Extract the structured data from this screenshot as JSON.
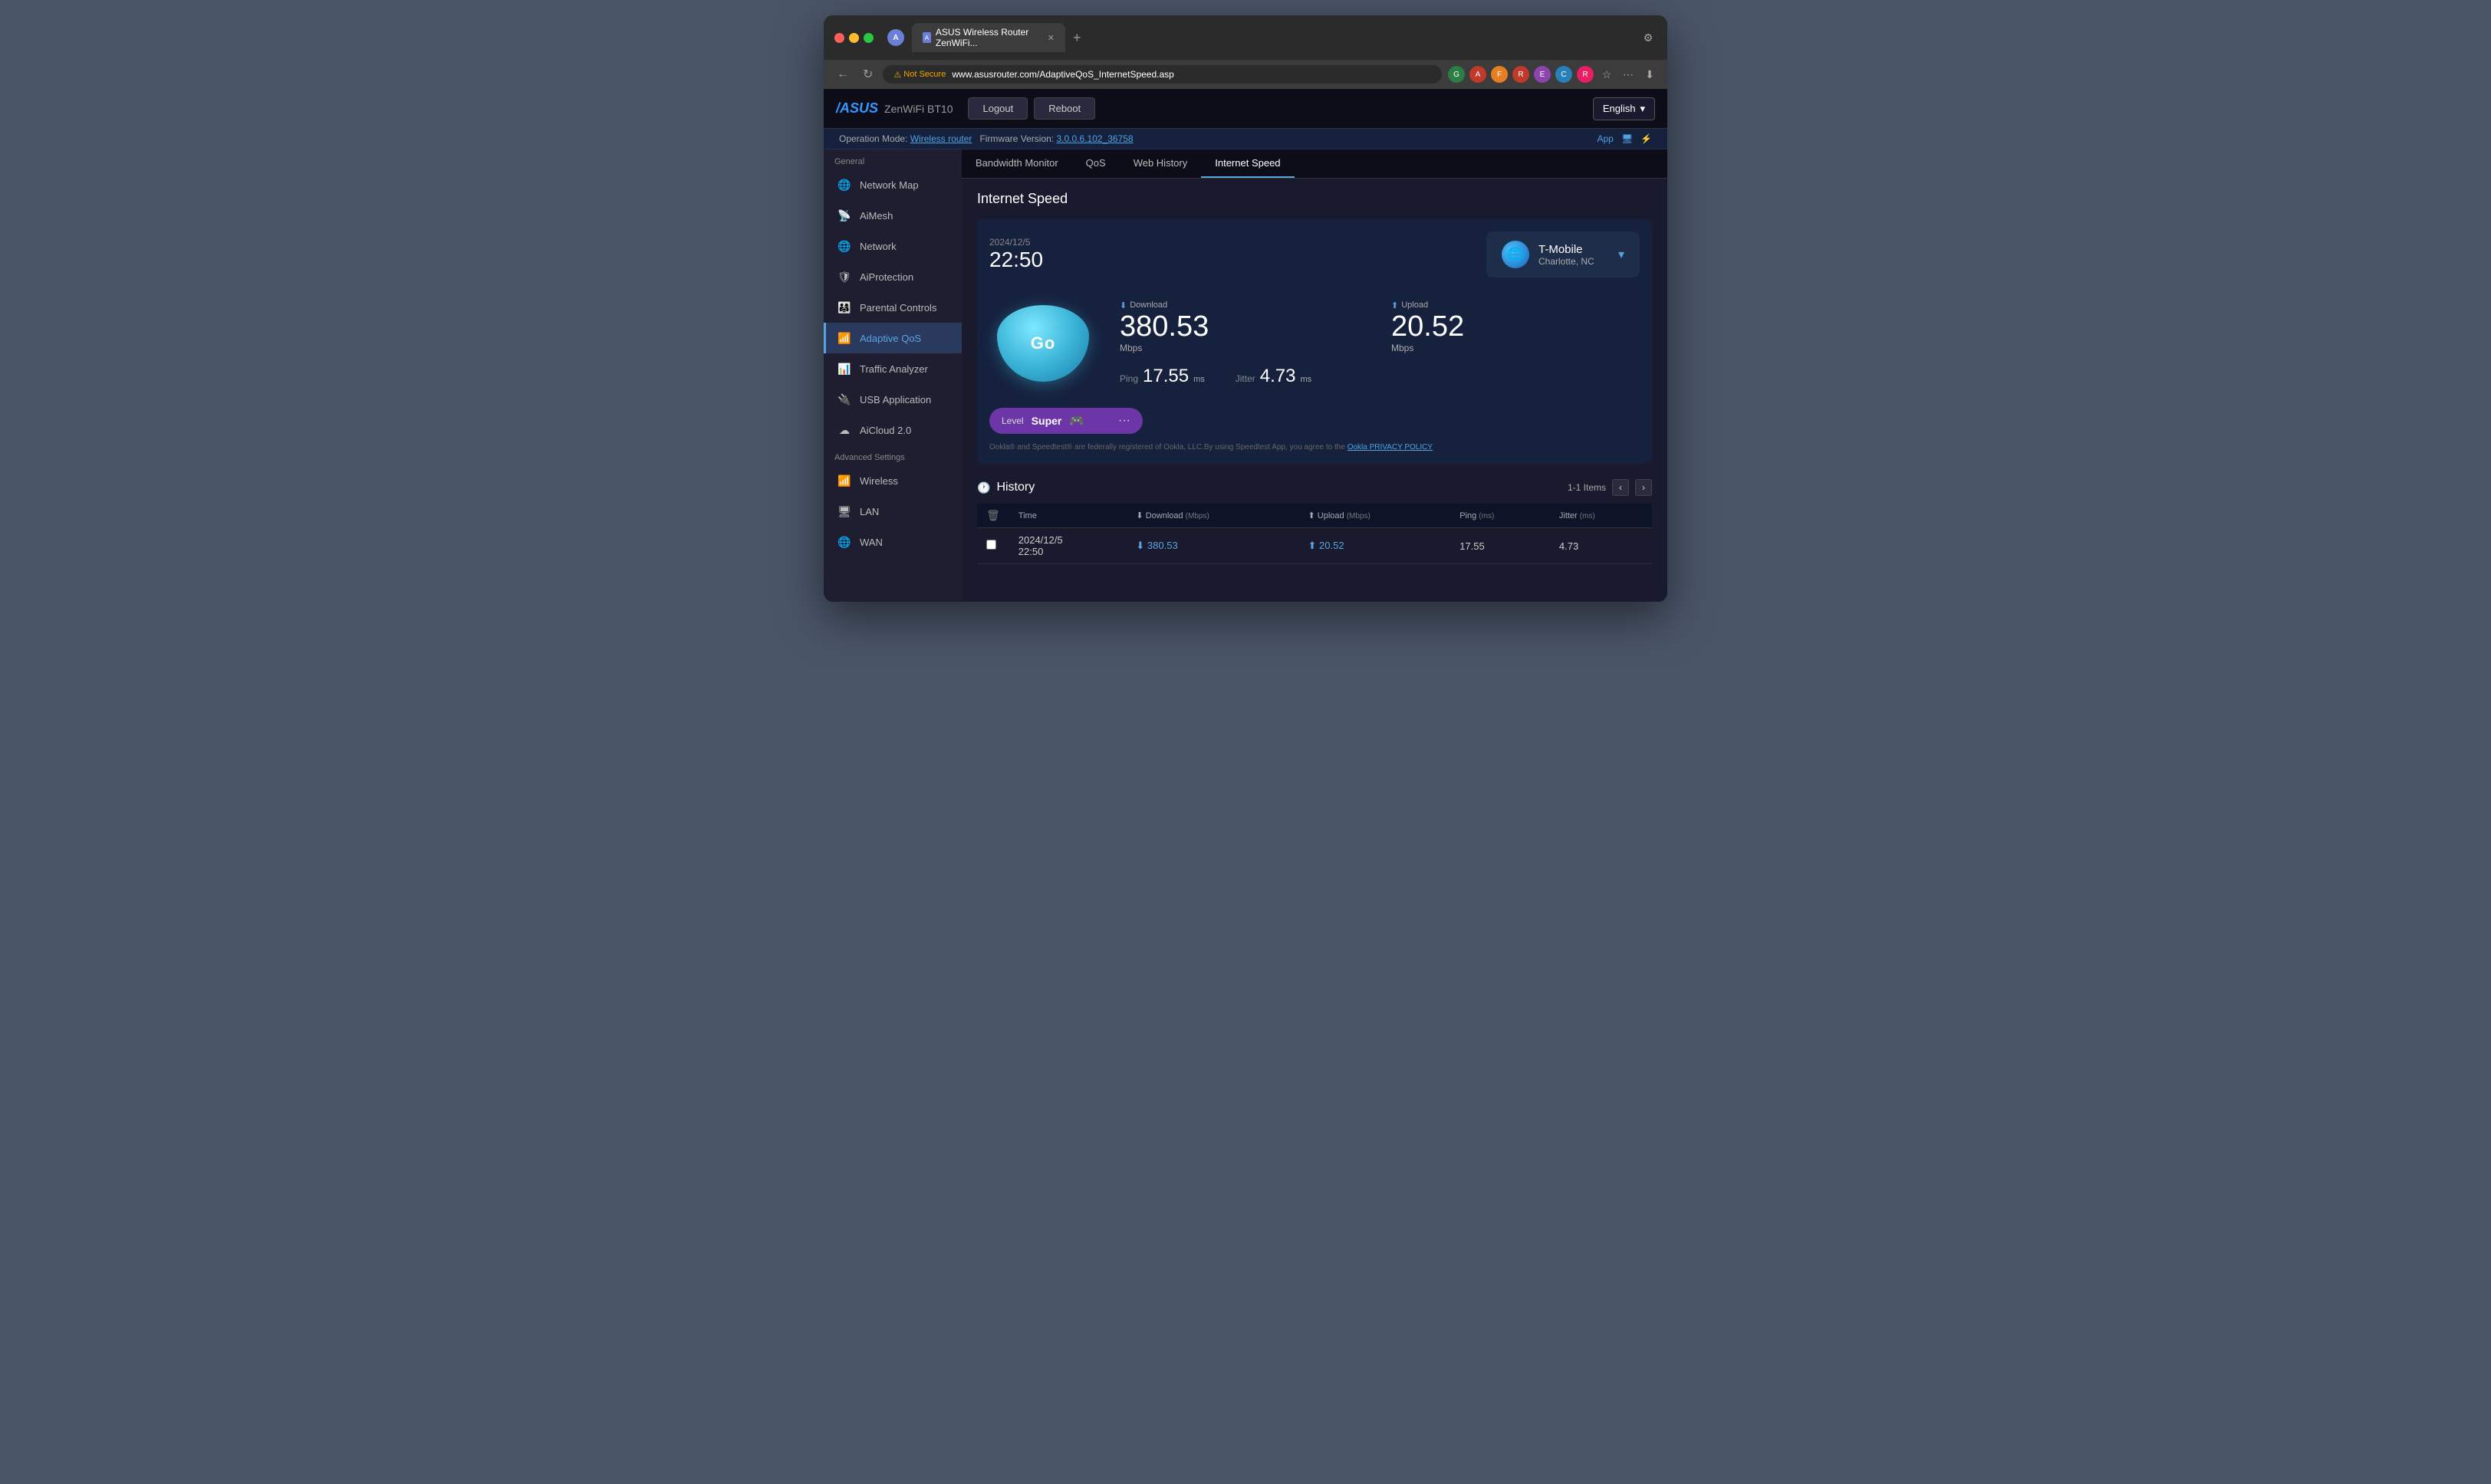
{
  "browser": {
    "tab_title": "ASUS Wireless Router ZenWiFi...",
    "favicon_label": "A",
    "url_not_secure": "Not Secure",
    "url_domain": "www.asusrouter.com",
    "url_path": "/AdaptiveQoS_InternetSpeed.asp",
    "new_tab_icon": "+",
    "back_icon": "←",
    "refresh_icon": "↻",
    "extensions": [
      "G",
      "A",
      "F",
      "R",
      "E",
      "C",
      "R"
    ],
    "star_icon": "☆",
    "menu_icon": "⋯",
    "download_icon": "⬇"
  },
  "router": {
    "brand": "/ASUS",
    "model": "ZenWiFi BT10",
    "logout_label": "Logout",
    "reboot_label": "Reboot",
    "language": "English",
    "op_mode_label": "Operation Mode:",
    "op_mode_value": "Wireless router",
    "firmware_label": "Firmware Version:",
    "firmware_value": "3.0.0.6.102_36758",
    "app_label": "App"
  },
  "tabs": [
    {
      "label": "Bandwidth Monitor",
      "active": false
    },
    {
      "label": "QoS",
      "active": false
    },
    {
      "label": "Web History",
      "active": false
    },
    {
      "label": "Internet Speed",
      "active": true
    }
  ],
  "sidebar": {
    "general_label": "General",
    "items_general": [
      {
        "id": "network-map",
        "label": "Network Map",
        "icon": "🌐"
      },
      {
        "id": "aimesh",
        "label": "AiMesh",
        "icon": "📡"
      },
      {
        "id": "network",
        "label": "Network",
        "icon": "🌐"
      },
      {
        "id": "aiprotection",
        "label": "AiProtection",
        "icon": "🛡"
      },
      {
        "id": "parental-controls",
        "label": "Parental Controls",
        "icon": "👨‍👩‍👧"
      },
      {
        "id": "adaptive-qos",
        "label": "Adaptive QoS",
        "icon": "📶",
        "active": true
      },
      {
        "id": "traffic-analyzer",
        "label": "Traffic Analyzer",
        "icon": "📊"
      },
      {
        "id": "usb-application",
        "label": "USB Application",
        "icon": "🔌"
      },
      {
        "id": "aicloud",
        "label": "AiCloud 2.0",
        "icon": "☁"
      }
    ],
    "advanced_label": "Advanced Settings",
    "items_advanced": [
      {
        "id": "wireless",
        "label": "Wireless",
        "icon": "📶"
      },
      {
        "id": "lan",
        "label": "LAN",
        "icon": "🖥"
      },
      {
        "id": "wan",
        "label": "WAN",
        "icon": "🌐"
      }
    ]
  },
  "content": {
    "page_title": "Internet Speed",
    "datetime_prefix": "2024/12/5",
    "time": "22:50",
    "provider_name": "T-Mobile",
    "provider_location": "Charlotte, NC",
    "go_button_label": "Go",
    "download_label": "Download",
    "upload_label": "Upload",
    "download_value": "380.53",
    "upload_value": "20.52",
    "speed_unit": "Mbps",
    "ping_label": "Ping",
    "ping_value": "17.55",
    "ping_unit": "ms",
    "jitter_label": "Jitter",
    "jitter_value": "4.73",
    "jitter_unit": "ms",
    "level_label": "Level",
    "level_value": "Super",
    "speedtest_note": "Ookla® and Speedtest® are federally registered of Ookla, LLC.By using Speedtest App, you agree to the",
    "speedtest_link": "Ookla PRIVACY POLICY",
    "history_title": "History",
    "items_count": "1-1 Items",
    "delete_icon": "🗑",
    "table_headers": [
      {
        "label": "Time",
        "sub": ""
      },
      {
        "label": "⬇ Download",
        "sub": "(Mbps)"
      },
      {
        "label": "⬆ Upload",
        "sub": "(Mbps)"
      },
      {
        "label": "Ping",
        "sub": "(ms)"
      },
      {
        "label": "Jitter",
        "sub": "(ms)"
      }
    ],
    "history_rows": [
      {
        "time": "2024/12/5\n22:50",
        "time_line1": "2024/12/5",
        "time_line2": "22:50",
        "download": "380.53",
        "upload": "20.52",
        "ping": "17.55",
        "jitter": "4.73"
      }
    ]
  }
}
